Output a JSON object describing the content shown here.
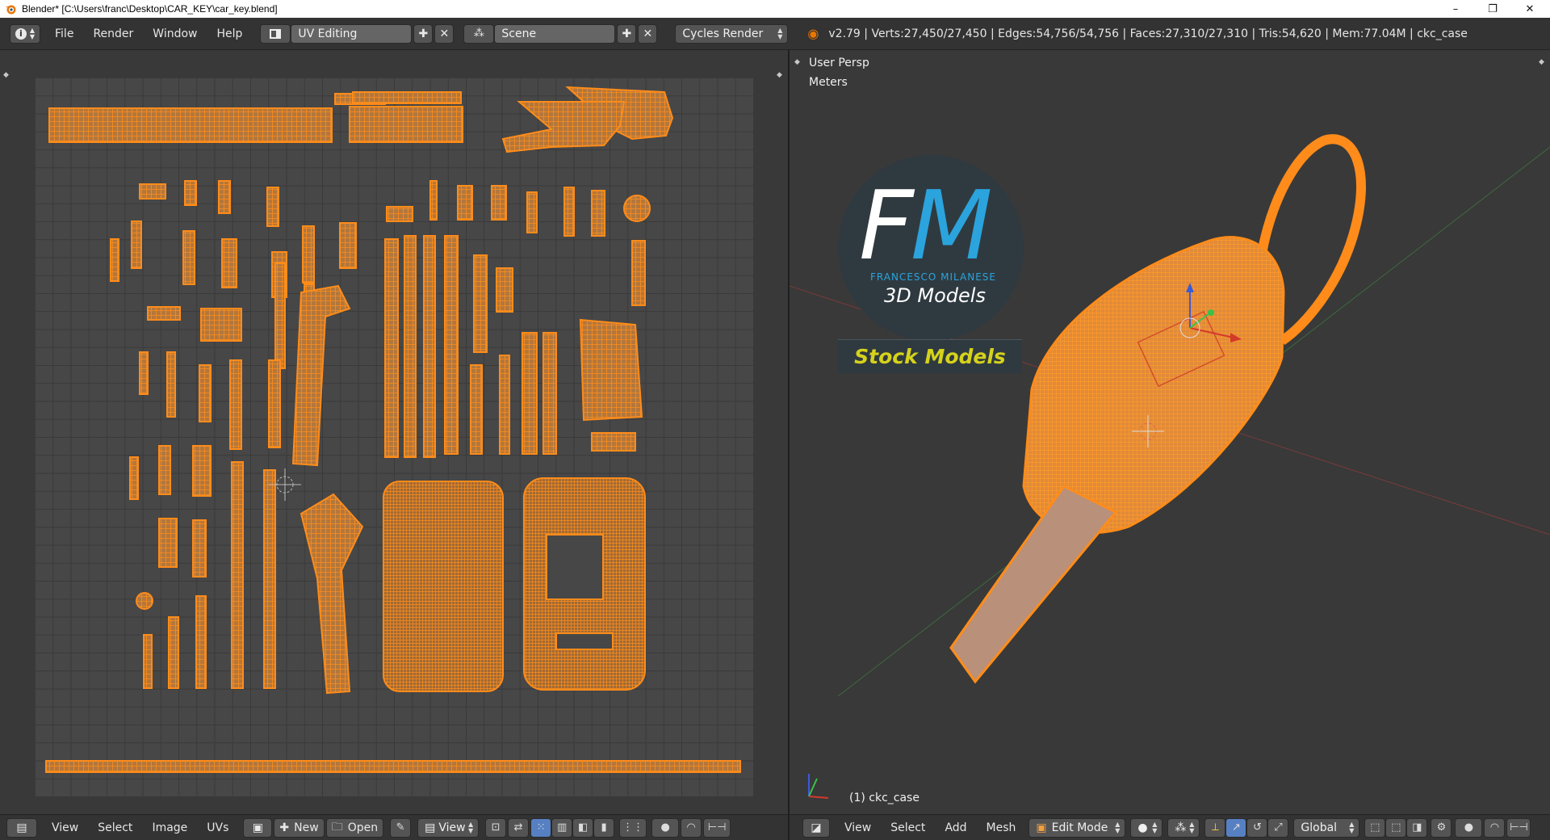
{
  "window": {
    "title": "Blender* [C:\\Users\\franc\\Desktop\\CAR_KEY\\car_key.blend]",
    "controls": [
      "–",
      "❐",
      "✕"
    ]
  },
  "info_header": {
    "menus": [
      "File",
      "Render",
      "Window",
      "Help"
    ],
    "screen_layout": "UV Editing",
    "scene": "Scene",
    "render_engine": "Cycles Render",
    "stats": "v2.79 | Verts:27,450/27,450 | Edges:54,756/54,756 | Faces:27,310/27,310 | Tris:54,620 | Mem:77.04M | ckc_case"
  },
  "uv_editor": {
    "menus": [
      "View",
      "Select",
      "Image",
      "UVs"
    ],
    "new_label": "New",
    "open_label": "Open",
    "view_label": "View"
  },
  "viewport": {
    "view_name": "User Persp",
    "units": "Meters",
    "object_label": "(1) ckc_case",
    "menus": [
      "View",
      "Select",
      "Add",
      "Mesh"
    ],
    "mode": "Edit Mode",
    "orientation": "Global"
  },
  "logo": {
    "letter_f": "F",
    "letter_m": "M",
    "name": "FRANCESCO MILANESE",
    "subtitle": "3D Models",
    "banner": "Stock Models"
  },
  "colors": {
    "mesh_orange": "#ff8c1a",
    "panel_bg": "#393939",
    "header_bg": "#333333",
    "logo_blue": "#2ba3dd",
    "logo_yellow": "#d6d21b"
  }
}
